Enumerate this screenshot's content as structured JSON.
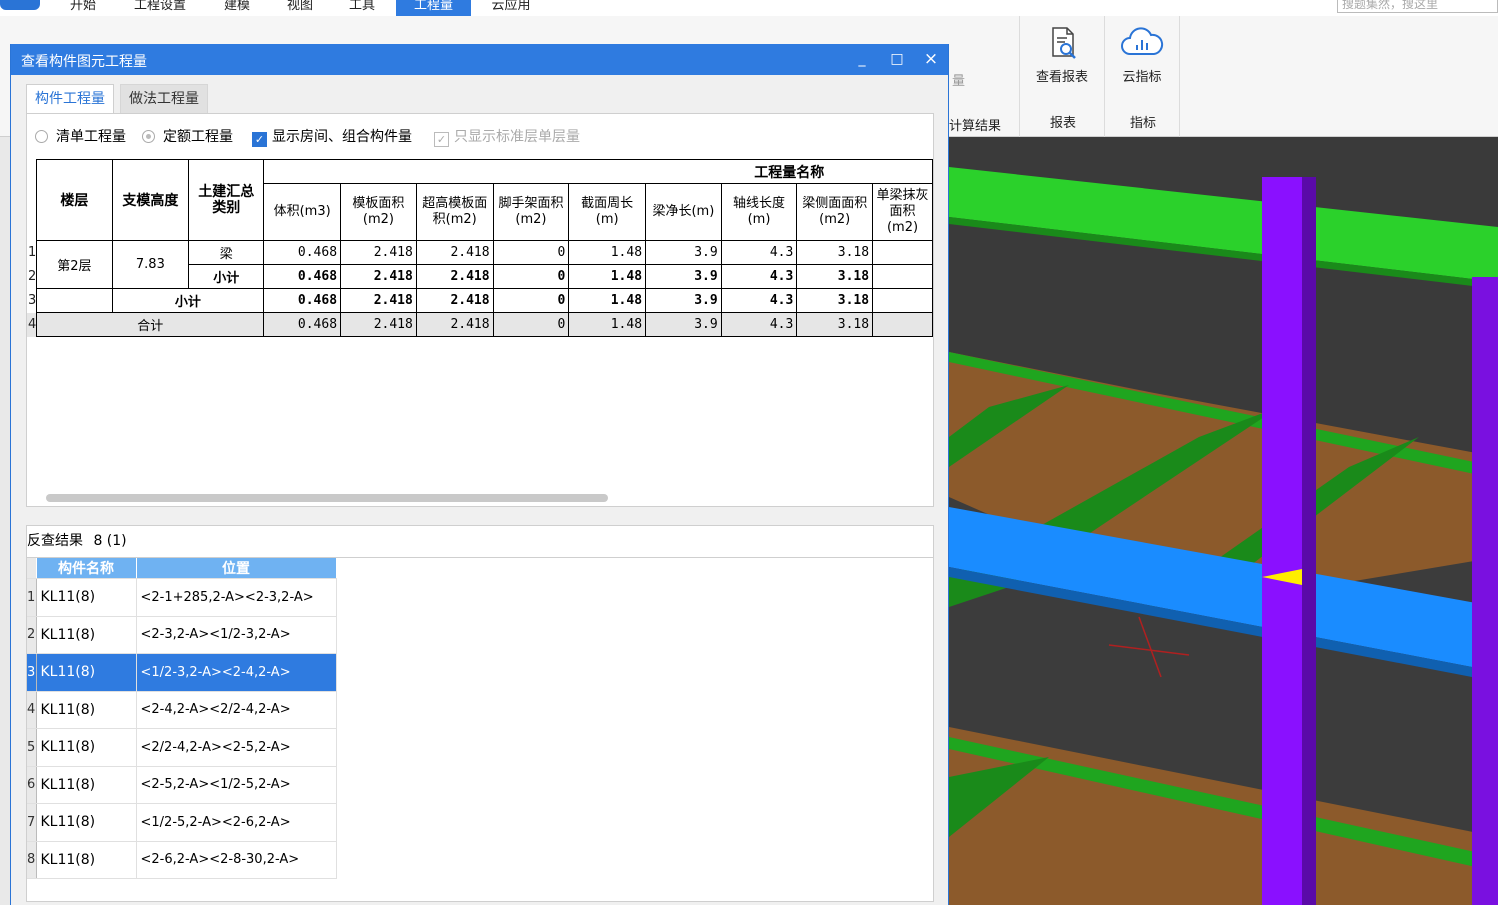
{
  "menu": {
    "tabs": [
      {
        "label": "开始"
      },
      {
        "label": "工程设置"
      },
      {
        "label": "建模"
      },
      {
        "label": "视图"
      },
      {
        "label": "工具"
      },
      {
        "label": "工程量"
      },
      {
        "label": "云应用"
      }
    ],
    "active_tab": "工程量",
    "search_placeholder": "搜题集然，搜这里"
  },
  "ribbon": {
    "partial_label": "计算结果",
    "partial_left": "量",
    "buttons": [
      {
        "label": "查看报表",
        "icon": "report-search-icon"
      },
      {
        "label": "云指标",
        "icon": "cloud-chart-icon"
      }
    ],
    "groups": [
      {
        "label": "报表"
      },
      {
        "label": "指标"
      }
    ]
  },
  "dialog": {
    "title": "查看构件图元工程量",
    "controls": {
      "minimize": "_",
      "maximize": "□",
      "close": "×"
    },
    "tabs": [
      {
        "label": "构件工程量",
        "active": true
      },
      {
        "label": "做法工程量",
        "active": false
      }
    ],
    "options": {
      "radio_list": "清单工程量",
      "radio_quota": "定额工程量",
      "check_rooms": "显示房间、组合构件量",
      "check_std_floor": "只显示标准层单层量",
      "check_mark": "✓"
    },
    "grid": {
      "group_header": "工程量名称",
      "headers": {
        "floor": "楼层",
        "height": "支模高度",
        "category": "土建汇总类别",
        "volume": "体积(m3)",
        "formwork": "模板面积(m2)",
        "high_formwork": "超高模板面积(m2)",
        "scaffold": "脚手架面积(m2)",
        "perimeter": "截面周长(m)",
        "net_length": "梁净长(m)",
        "axis_length": "轴线长度(m)",
        "side_area": "梁侧面面积(m2)",
        "single_plaster": "单梁抹灰面积(m2)"
      },
      "row_numbers": [
        "1",
        "2",
        "3",
        "4"
      ],
      "floor_value": "第2层",
      "height_value": "7.83",
      "rows": [
        {
          "category": "梁",
          "values": [
            "0.468",
            "2.418",
            "2.418",
            "0",
            "1.48",
            "3.9",
            "4.3",
            "3.18"
          ]
        },
        {
          "category": "小计",
          "values": [
            "0.468",
            "2.418",
            "2.418",
            "0",
            "1.48",
            "3.9",
            "4.3",
            "3.18"
          ]
        },
        {
          "category": "小计",
          "values": [
            "0.468",
            "2.418",
            "2.418",
            "0",
            "1.48",
            "3.9",
            "4.3",
            "3.18"
          ]
        },
        {
          "category": "合计",
          "values": [
            "0.468",
            "2.418",
            "2.418",
            "0",
            "1.48",
            "3.9",
            "4.3",
            "3.18"
          ]
        }
      ]
    },
    "reverse": {
      "title": "反查结果",
      "count": "8 (1)",
      "headers": {
        "name": "构件名称",
        "position": "位置"
      },
      "selected_index": 2,
      "rows": [
        {
          "num": "1",
          "name": "KL11(8)",
          "position": "<2-1+285,2-A><2-3,2-A>"
        },
        {
          "num": "2",
          "name": "KL11(8)",
          "position": "<2-3,2-A><1/2-3,2-A>"
        },
        {
          "num": "3",
          "name": "KL11(8)",
          "position": "<1/2-3,2-A><2-4,2-A>"
        },
        {
          "num": "4",
          "name": "KL11(8)",
          "position": "<2-4,2-A><2/2-4,2-A>"
        },
        {
          "num": "5",
          "name": "KL11(8)",
          "position": "<2/2-4,2-A><2-5,2-A>"
        },
        {
          "num": "6",
          "name": "KL11(8)",
          "position": "<2-5,2-A><1/2-5,2-A>"
        },
        {
          "num": "7",
          "name": "KL11(8)",
          "position": "<1/2-5,2-A><2-6,2-A>"
        },
        {
          "num": "8",
          "name": "KL11(8)",
          "position": "<2-6,2-A><2-8-30,2-A>"
        }
      ]
    }
  },
  "colors": {
    "accent": "#2f7be0",
    "beam_blue": "#1a8cff",
    "beam_green": "#22cc22",
    "column_purple": "#8a10ff",
    "slab_brown": "#8c5a2b",
    "viewport_bg": "#3a3a3a"
  }
}
